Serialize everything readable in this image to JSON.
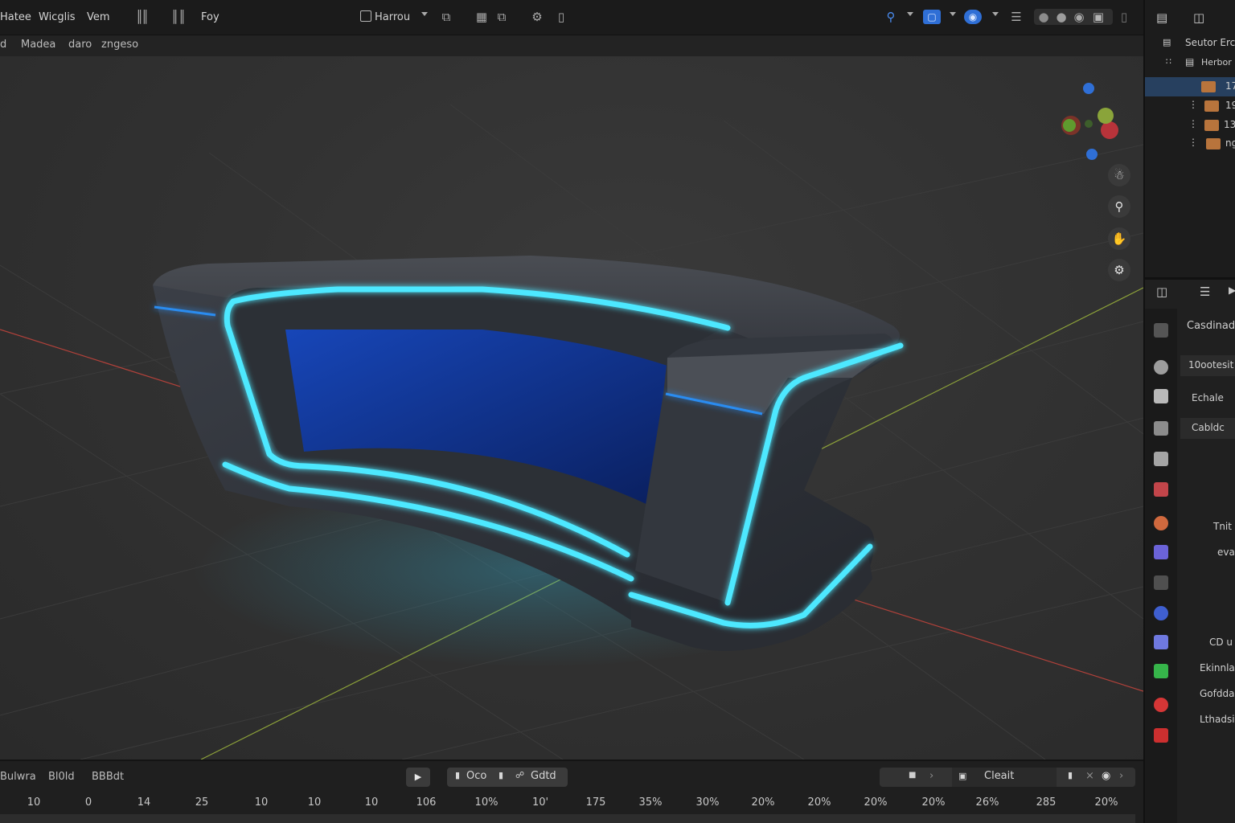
{
  "menu": [
    "Hatee",
    "Wicglis",
    "Vem",
    "Foy"
  ],
  "header_menu": [
    "Madea",
    "daro",
    "zngeso"
  ],
  "mode": {
    "label": "Harrou"
  },
  "outliner": {
    "header": "Seutor Erc",
    "collection": "Herbor",
    "rows": [
      "17",
      "19",
      "13",
      "ng"
    ]
  },
  "properties": {
    "title": "Casdinadu",
    "field1": "10ootesit",
    "field2": "Echale",
    "section1": "Cabldc",
    "label1": "Tnit",
    "label2": "evat",
    "sections": [
      "CD u",
      "Ekinnla",
      "Gofdda",
      "Lthadsi"
    ]
  },
  "timeline": {
    "left_labels": [
      "Bulwra",
      "Bl0ld",
      "BBBdt"
    ],
    "play_group": [
      "Oco",
      "Gdtd"
    ],
    "right_group": "Cleait",
    "frames": [
      "10",
      "0",
      "14",
      "25",
      "10",
      "10",
      "10",
      "106",
      "10%",
      "10'",
      "175",
      "35%",
      "30%",
      "20%",
      "20%",
      "20%",
      "20%",
      "26%",
      "285",
      "20%"
    ]
  },
  "colors": {
    "accent_blue": "#2f6fd6",
    "glow_cyan": "#4de8ff",
    "screen_blue": "#0d2a78",
    "axis_red": "#c0392b",
    "axis_green": "#9ab83a",
    "selection": "#27405f"
  },
  "icons": {
    "search": "magnifier-icon",
    "play": "play-icon"
  }
}
